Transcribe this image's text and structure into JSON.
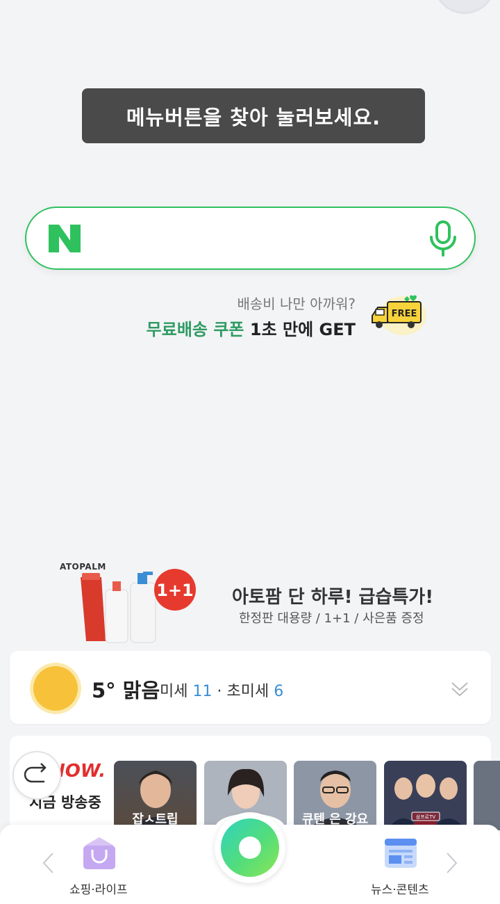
{
  "tooltip": {
    "text": "메뉴버튼을 찾아 눌러보세요."
  },
  "search": {
    "logo": "N",
    "placeholder": "",
    "mic_icon": "microphone-icon",
    "accent_color": "#2fc15d"
  },
  "promo": {
    "subtitle": "배송비 나만 아까워?",
    "highlight": "무료배송 쿠폰",
    "rest": " 1초 만에 GET",
    "badge": "FREE",
    "highlight_color": "#2e9b63"
  },
  "ad": {
    "brand": "ATOPALM",
    "badge": "1+1",
    "title": "아토팜 단 하루! 급습특가!",
    "subtitle": "한정판 대용량 / 1+1 / 사은품 증정"
  },
  "weather": {
    "temp": "5°",
    "condition": "맑음",
    "dust_label": "미세",
    "dust_value": "11",
    "separator": " · ",
    "fine_dust_label": "초미세",
    "fine_dust_value": "6",
    "icon": "sun-icon"
  },
  "live": {
    "logo": "NOW.",
    "label": "지금 방송중",
    "thumbnails": [
      {
        "caption": "잡ㅅ트립",
        "color": "#5a4a3e"
      },
      {
        "caption": "",
        "color": "#9aa0ac"
      },
      {
        "caption": "큐텐 은 강요",
        "color": "#3e4a5a"
      },
      {
        "caption": "삼프로TV",
        "color": "#7a2a3a"
      },
      {
        "caption": "",
        "color": "#6a7280"
      }
    ]
  },
  "bottom_nav": {
    "left_label": "쇼핑·라이프",
    "right_label": "뉴스·콘텐츠",
    "left_icon": "shopping-bag-icon",
    "right_icon": "news-icon",
    "center_icon": "green-dot-icon"
  }
}
